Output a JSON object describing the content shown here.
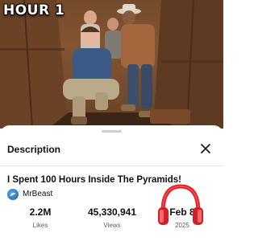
{
  "thumbnail": {
    "overlay_text": "HOUR 1"
  },
  "description_panel": {
    "title": "Description",
    "close_icon": "close-icon"
  },
  "video": {
    "title": "I Spent 100 Hours Inside The Pyramids!",
    "channel": "MrBeast",
    "stats": [
      {
        "value": "2.2M",
        "label": "Likes"
      },
      {
        "value": "45,330,941",
        "label": "Views"
      },
      {
        "value": "Feb 8",
        "label": "2025"
      }
    ]
  },
  "colors": {
    "headphones_accent": "#e3222a",
    "text_primary": "#0f0f0f",
    "text_secondary": "#606060"
  }
}
